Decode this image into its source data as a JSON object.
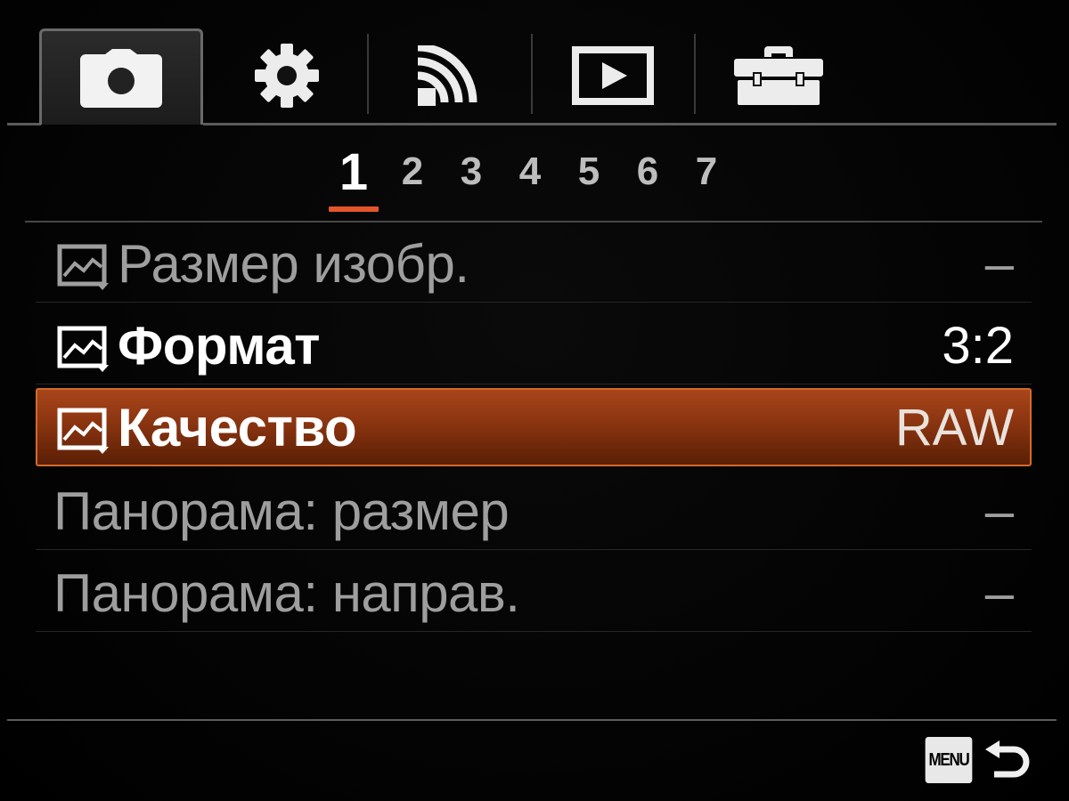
{
  "tabs": [
    {
      "icon": "camera-icon",
      "active": true
    },
    {
      "icon": "gear-icon",
      "active": false
    },
    {
      "icon": "wireless-icon",
      "active": false
    },
    {
      "icon": "playback-icon",
      "active": false
    },
    {
      "icon": "toolbox-icon",
      "active": false
    }
  ],
  "pages": {
    "items": [
      "1",
      "2",
      "3",
      "4",
      "5",
      "6",
      "7"
    ],
    "active": "1"
  },
  "menu": {
    "rows": [
      {
        "label": "Размер изобр.",
        "value": "–",
        "icon": "still-image-icon",
        "state": "dim"
      },
      {
        "label": "Формат",
        "value": "3:2",
        "icon": "still-image-icon",
        "state": "bright"
      },
      {
        "label": "Качество",
        "value": "RAW",
        "icon": "still-image-icon",
        "state": "selected"
      },
      {
        "label": "Панорама: размер",
        "value": "–",
        "icon": "",
        "state": "dim"
      },
      {
        "label": "Панорама: направ.",
        "value": "–",
        "icon": "",
        "state": "dim"
      }
    ]
  },
  "footer": {
    "menu_label": "MENU",
    "back_icon": "return-arrow-icon"
  },
  "colors": {
    "accent": "#e4562a",
    "selected_row": "#8a3410",
    "dim_text": "#9e9e9e"
  }
}
